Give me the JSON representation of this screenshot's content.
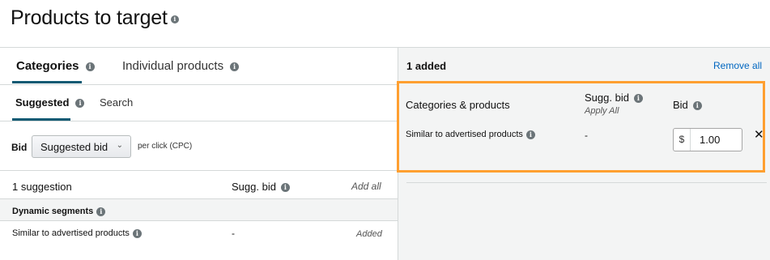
{
  "page": {
    "title": "Products to target"
  },
  "tabs": [
    {
      "label": "Categories",
      "active": true
    },
    {
      "label": "Individual products",
      "active": false
    }
  ],
  "subtabs": [
    {
      "label": "Suggested",
      "active": true
    },
    {
      "label": "Search",
      "active": false
    }
  ],
  "bid_control": {
    "label": "Bid",
    "selected": "Suggested bid",
    "suffix": "per click (CPC)"
  },
  "suggestions": {
    "count_label": "1 suggestion",
    "sugg_bid_header": "Sugg. bid",
    "add_all": "Add all",
    "group": "Dynamic segments",
    "items": [
      {
        "label": "Similar to advertised products",
        "sugg_bid": "-",
        "status": "Added"
      }
    ]
  },
  "added_panel": {
    "count_label": "1 added",
    "remove_all": "Remove all",
    "headers": {
      "name": "Categories & products",
      "sugg_bid": "Sugg. bid",
      "apply_all": "Apply All",
      "bid": "Bid"
    },
    "items": [
      {
        "label": "Similar to advertised products",
        "sugg_bid": "-",
        "currency": "$",
        "bid": "1.00"
      }
    ]
  },
  "colors": {
    "accent": "#0f5a73",
    "link": "#0066c0",
    "highlight": "#ff9f30"
  }
}
